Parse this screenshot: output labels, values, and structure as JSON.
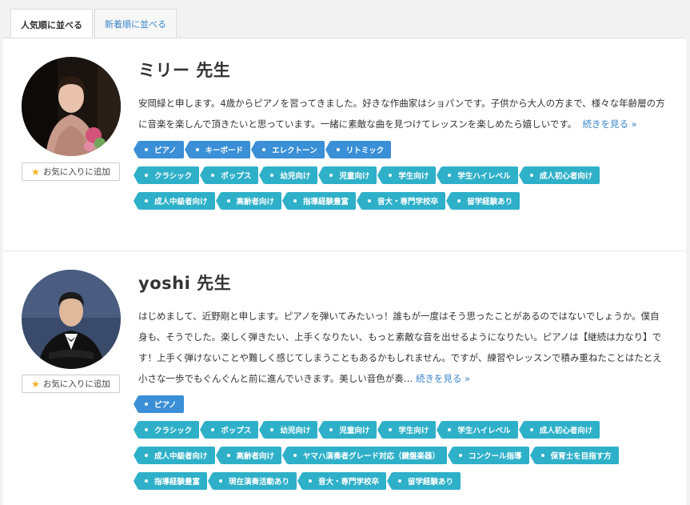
{
  "tabs": [
    {
      "label": "人気順に並べる",
      "active": true
    },
    {
      "label": "新着順に並べる",
      "active": false
    }
  ],
  "fav_label": "お気に入りに追加",
  "more_label": "続きを見る »",
  "colors": {
    "instrument_tag": "#3a8fd6",
    "feature_tag": "#2fb0c9",
    "link": "#3a86c8"
  },
  "teachers": [
    {
      "name": "ミリー 先生",
      "bio": "安岡緑と申します。4歳からピアノを習ってきました。好きな作曲家はショパンです。子供から大人の方まで、様々な年齢層の方に音楽を楽しんで頂きたいと思っています。一緒に素敵な曲を見つけてレッスンを楽しめたら嬉しいです。",
      "instrument_tags": [
        "ピアノ",
        "キーボード",
        "エレクトーン",
        "リトミック"
      ],
      "feature_tags": [
        [
          "クラシック",
          "ポップス",
          "幼児向け",
          "児童向け",
          "学生向け",
          "学生ハイレベル",
          "成人初心者向け"
        ],
        [
          "成人中級者向け",
          "高齢者向け",
          "指導経験豊富",
          "音大・専門学校卒",
          "留学経験あり"
        ]
      ]
    },
    {
      "name": "yoshi 先生",
      "bio": "はじめまして、近野剛と申します。ピアノを弾いてみたいっ！誰もが一度はそう思ったことがあるのではないでしょうか。僕自身も、そうでした。楽しく弾きたい、上手くなりたい、もっと素敵な音を出せるようになりたい。ピアノは【継続は力なり】です！上手く弾けないことや難しく感じてしまうこともあるかもしれません。ですが、練習やレッスンで積み重ねたことはたとえ小さな一歩でもぐんぐんと前に進んでいきます。美しい音色が奏…",
      "instrument_tags": [
        "ピアノ"
      ],
      "feature_tags": [
        [
          "クラシック",
          "ポップス",
          "幼児向け",
          "児童向け",
          "学生向け",
          "学生ハイレベル",
          "成人初心者向け"
        ],
        [
          "成人中級者向け",
          "高齢者向け",
          "ヤマハ演奏者グレード対応（鍵盤楽器）",
          "コンクール指導",
          "保育士を目指す方"
        ],
        [
          "指導経験豊富",
          "現在演奏活動あり",
          "音大・専門学校卒",
          "留学経験あり"
        ]
      ]
    }
  ]
}
